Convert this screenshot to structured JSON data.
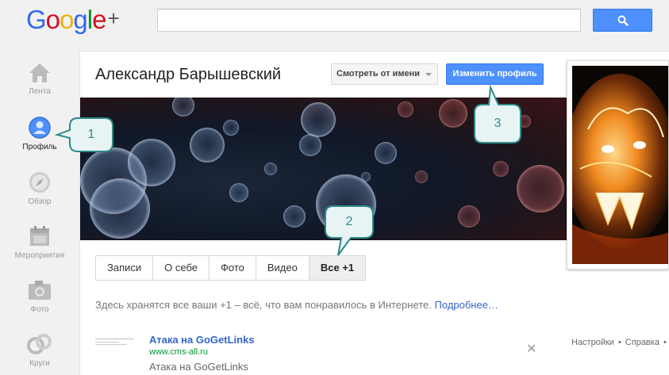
{
  "header": {
    "logo_text": "Google",
    "logo_plus": "+",
    "search_placeholder": "",
    "search_icon": "search-icon"
  },
  "nav": {
    "items": [
      {
        "label": "Лента",
        "icon": "home-icon",
        "active": false
      },
      {
        "label": "Профиль",
        "icon": "profile-icon",
        "active": true
      },
      {
        "label": "Обзор",
        "icon": "compass-icon",
        "active": false
      },
      {
        "label": "Мероприятия",
        "icon": "calendar-icon",
        "active": false
      },
      {
        "label": "Фото",
        "icon": "camera-icon",
        "active": false
      },
      {
        "label": "Круги",
        "icon": "circles-icon",
        "active": false
      }
    ]
  },
  "profile": {
    "name": "Александр Барышевский",
    "view_as_label": "Смотреть от имени",
    "edit_button_label": "Изменить профиль"
  },
  "tabs": [
    {
      "label": "Записи",
      "active": false
    },
    {
      "label": "О себе",
      "active": false
    },
    {
      "label": "Фото",
      "active": false
    },
    {
      "label": "Видео",
      "active": false
    },
    {
      "label": "Все +1",
      "active": true
    }
  ],
  "info": {
    "text": "Здесь хранятся все ваши +1 – всё, что вам понравилось в Интернете.",
    "link": "Подробнее…"
  },
  "item": {
    "title": "Атака на GoGetLinks",
    "url": "www.cms-all.ru",
    "description": "Атака на GoGetLinks",
    "close_symbol": "✕"
  },
  "footer": {
    "links": [
      "Настройки",
      "Справка"
    ]
  },
  "callouts": [
    "1",
    "2",
    "3"
  ],
  "colors": {
    "accent_blue": "#4d90fe",
    "link_blue": "#3366cc",
    "url_green": "#009933",
    "callout_teal": "#2d8a8a"
  }
}
